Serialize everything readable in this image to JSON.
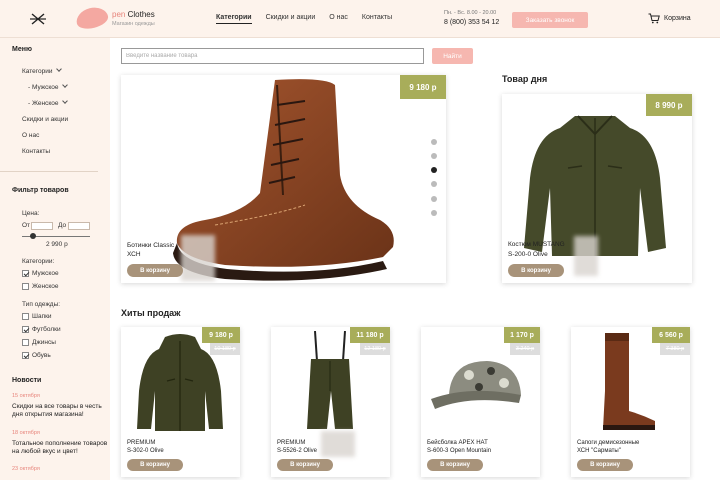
{
  "header": {
    "logo_prefix": "pen",
    "logo_name": "Clothes",
    "logo_subtitle": "Магазин одежды",
    "nav": [
      "Категории",
      "Скидки и акции",
      "О нас",
      "Контакты"
    ],
    "hours": "Пн. - Вс. 8.00 - 20.00",
    "phone": "8 (800) 353 54 12",
    "call_button": "Заказать звонок",
    "cart_label": "Корзина"
  },
  "sidebar": {
    "menu_title": "Меню",
    "menu_items": [
      "Категории",
      "- Мужское",
      "- Женское",
      "Скидки и акции",
      "О нас",
      "Контакты"
    ],
    "filter_title": "Фильтр товаров",
    "price_label": "Цена:",
    "price_from": "От",
    "price_to": "До",
    "price_value": "2 990 р",
    "categories_label": "Категории:",
    "categories": [
      {
        "label": "Мужское",
        "checked": true
      },
      {
        "label": "Женское",
        "checked": false
      }
    ],
    "clothing_type_label": "Тип одежды:",
    "clothing_types": [
      {
        "label": "Шапки",
        "checked": false
      },
      {
        "label": "Футболки",
        "checked": true
      },
      {
        "label": "Джинсы",
        "checked": false
      },
      {
        "label": "Обувь",
        "checked": true
      }
    ],
    "news_title": "Новости",
    "news": [
      {
        "date": "15 октября",
        "text": "Скидки на все товары в честь дня открытия магазина!"
      },
      {
        "date": "18 октября",
        "text": "Тотальное пополнение товаров на любой вкус и цвет!"
      },
      {
        "date": "23 октября",
        "text": ""
      }
    ]
  },
  "search": {
    "placeholder": "Введите название товара",
    "button": "Найти"
  },
  "featured": {
    "price": "9 180 р",
    "name_line1": "Ботинки Classic",
    "name_line2": "ХСН",
    "cart_button": "В корзину",
    "slide_count": 6,
    "active_slide": 3
  },
  "deal": {
    "title": "Товар дня",
    "price": "8 990 р",
    "name_line1": "Костюм MUSTANG",
    "name_line2": "S-200-0 Olive",
    "cart_button": "В корзину"
  },
  "bestsellers": {
    "title": "Хиты продаж",
    "items": [
      {
        "price": "9 180 р",
        "old_price": "10 180 р",
        "name_line1": "PREMIUM",
        "name_line2": "S-302-0 Olive",
        "cart_button": "В корзину",
        "image": "jacket"
      },
      {
        "price": "11 180 р",
        "old_price": "12 180 р",
        "name_line1": "PREMIUM",
        "name_line2": "S-5526-2 Olive",
        "cart_button": "В корзину",
        "image": "overalls"
      },
      {
        "price": "1 170 р",
        "old_price": "3 240 р",
        "name_line1": "Бейсболка APEX HAT",
        "name_line2": "S-600-3 Open Mountain",
        "cart_button": "В корзину",
        "image": "cap"
      },
      {
        "price": "6 560 р",
        "old_price": "7 380 р",
        "name_line1": "Сапоги демисезонные",
        "name_line2": "ХСН \"Сарматы\"",
        "cart_button": "В корзину",
        "image": "boots"
      }
    ]
  }
}
